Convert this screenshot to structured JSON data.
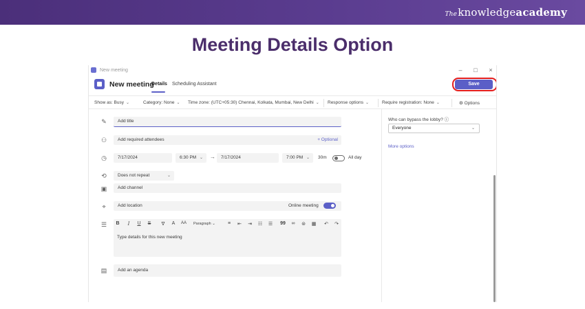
{
  "banner": {
    "brand_prefix": "The",
    "brand_main": "knowledge",
    "brand_bold": "academy"
  },
  "heading": "Meeting Details Option",
  "window": {
    "title": "New meeting",
    "controls": {
      "minimize": "–",
      "maximize": "□",
      "close": "×"
    }
  },
  "header": {
    "title": "New meeting",
    "tabs": [
      {
        "label": "Details",
        "active": true
      },
      {
        "label": "Scheduling Assistant",
        "active": false
      }
    ],
    "save_label": "Save"
  },
  "toolbar": {
    "show_as": "Show as: Busy",
    "category": "Category: None",
    "timezone": "Time zone: (UTC+05:30) Chennai, Kolkata, Mumbai, New Delhi",
    "response": "Response options",
    "registration": "Require registration: None",
    "options": "Options"
  },
  "form": {
    "title_placeholder": "Add title",
    "attendees_placeholder": "Add required attendees",
    "optional_label": "+ Optional",
    "start_date": "7/17/2024",
    "start_time": "6:30 PM",
    "end_date": "7/17/2024",
    "end_time": "7:00 PM",
    "duration": "30m",
    "all_day": "All day",
    "all_day_on": false,
    "repeat": "Does not repeat",
    "channel_placeholder": "Add channel",
    "location_placeholder": "Add location",
    "online_meeting": "Online meeting",
    "online_meeting_on": true,
    "format": {
      "bold": "B",
      "italic": "I",
      "underline": "U",
      "strike": "S",
      "paragraph": "Paragraph",
      "quote": "99"
    },
    "details_placeholder": "Type details for this new meeting",
    "agenda_placeholder": "Add an agenda"
  },
  "side": {
    "lobby_label": "Who can bypass the lobby?",
    "lobby_value": "Everyone",
    "more_options": "More options"
  },
  "colors": {
    "accent": "#5b5fc7",
    "banner": "#4b2f7a",
    "heading": "#4b2e6b",
    "highlight": "#e31c1c"
  }
}
